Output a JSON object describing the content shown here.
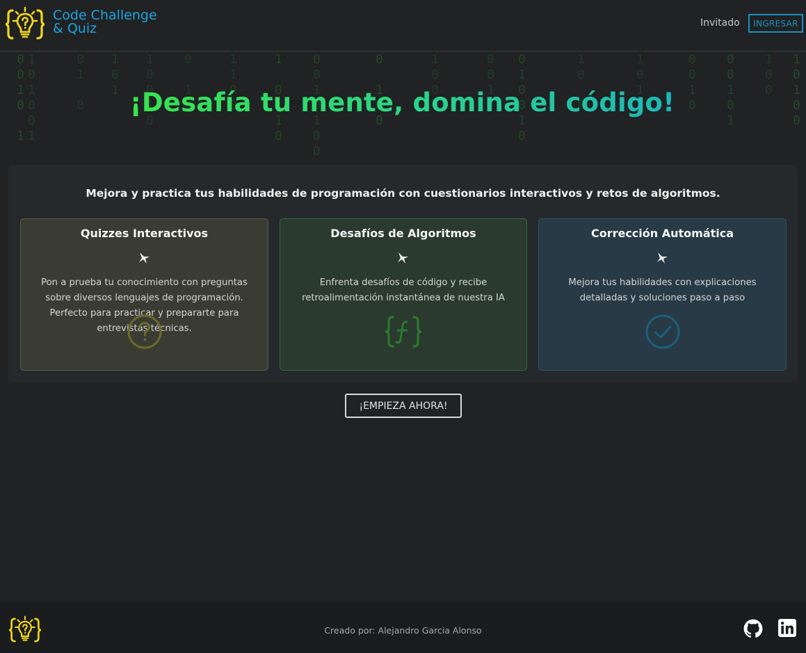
{
  "header": {
    "brand_line1": "Code Challenge",
    "brand_line2": "& Quiz",
    "user_name": "Invitado",
    "login_label": "INGRESAR"
  },
  "hero": {
    "title": "¡Desafía tu mente, domina el código!"
  },
  "features": {
    "intro": "Mejora y practica tus habilidades de programación con cuestionarios interactivos y retos de algoritmos.",
    "cards": [
      {
        "title": "Quizzes Interactivos",
        "description": "Pon a prueba tu conocimiento con preguntas sobre diversos lenguajes de programación. Perfecto para practicar y prepararte para entrevistas técnicas.",
        "icon": "question-circle-icon"
      },
      {
        "title": "Desafíos de Algoritmos",
        "description": "Enfrenta desafíos de código y recibe retroalimentación instantánea de nuestra IA",
        "icon": "function-braces-icon"
      },
      {
        "title": "Corrección Automática",
        "description": "Mejora tus habilidades con explicaciones detalladas y soluciones paso a paso",
        "icon": "check-circle-icon"
      }
    ]
  },
  "cta": {
    "label": "¡EMPIEZA AHORA!"
  },
  "footer": {
    "credit": "Creado por: Alejandro Garcia Alonso"
  },
  "colors": {
    "brand": "#1da4e0",
    "accent_green": "#39e34d",
    "logo_yellow": "#f2d71e"
  }
}
